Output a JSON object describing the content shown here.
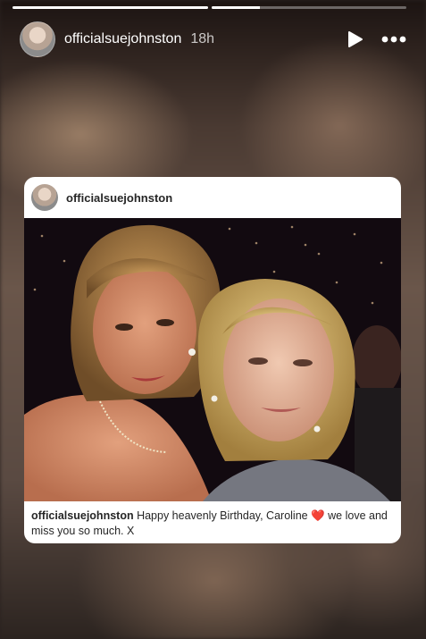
{
  "story": {
    "progress": [
      1.0,
      0.25
    ]
  },
  "header": {
    "username": "officialsuejohnston",
    "time": "18h",
    "play_icon": "play-icon",
    "more_icon": "more-options-icon"
  },
  "post": {
    "username": "officialsuejohnston",
    "caption_user": "officialsuejohnston",
    "caption_text_1": " Happy heavenly Birthday, Caroline ",
    "caption_heart": "❤️",
    "caption_text_2": " we love and miss you so much.  X"
  },
  "colors": {
    "heart": "#e0245e"
  }
}
